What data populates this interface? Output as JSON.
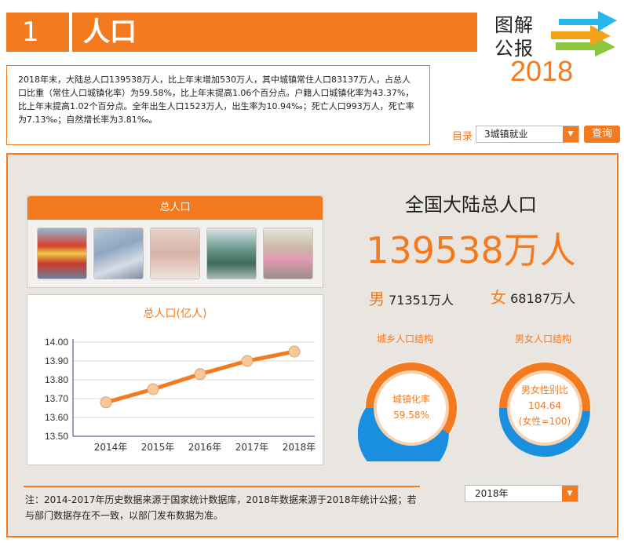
{
  "header": {
    "section_number": "1",
    "section_title": "人口"
  },
  "logo": {
    "line1": "图解",
    "line2": "公报",
    "year": "2018"
  },
  "summary": "2018年末，大陆总人口139538万人，比上年末增加530万人，其中城镇常住人口83137万人，占总人口比重（常住人口城镇化率）为59.58%，比上年末提高1.06个百分点。户籍人口城镇化率为43.37%，比上年末提高1.02个百分点。全年出生人口1523万人，出生率为10.94‰；死亡人口993万人，死亡率为7.13‰；自然增长率为3.81‰。",
  "catalog": {
    "label": "目录",
    "selected": "3城镇就业",
    "query_button": "查询"
  },
  "pictures": {
    "tab_label": "总人口"
  },
  "stats": {
    "title": "全国大陆总人口",
    "total": "139538万人",
    "male_label": "男",
    "male_value": "71351万人",
    "female_label": "女",
    "female_value": "68187万人"
  },
  "rings": {
    "urban": {
      "title": "城乡人口结构",
      "label": "城镇化率",
      "value": "59.58%",
      "fraction": 0.5958
    },
    "gender": {
      "title": "男女人口结构",
      "label": "男女性别比",
      "value": "104.64",
      "sub": "(女性=100)",
      "fraction": 0.5113
    }
  },
  "note": "注：2014-2017年历史数据来源于国家统计数据库，2018年数据来源于2018年统计公报；若与部门数据存在不一致，以部门发布数据为准。",
  "year_select": {
    "selected": "2018年"
  },
  "colors": {
    "accent": "#f47a1f",
    "blue": "#1a8fe0",
    "panel_bg": "#e9e5e1"
  },
  "chart_data": {
    "type": "line",
    "title": "总人口(亿人)",
    "categories": [
      "2014年",
      "2015年",
      "2016年",
      "2017年",
      "2018年"
    ],
    "values": [
      13.68,
      13.75,
      13.83,
      13.9,
      13.95
    ],
    "ylim": [
      13.5,
      14.0
    ],
    "yticks": [
      "14.00",
      "13.90",
      "13.80",
      "13.70",
      "13.60",
      "13.50"
    ],
    "grid": true
  }
}
